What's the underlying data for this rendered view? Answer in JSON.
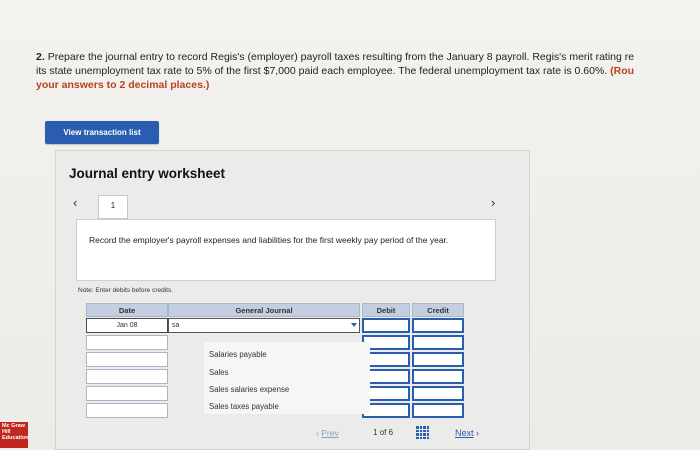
{
  "question": {
    "number": "2.",
    "line1": "Prepare the journal entry to record Regis's (employer) payroll taxes resulting from the January 8 payroll. Regis's merit rating re",
    "line2_text": "its state unemployment tax rate to 5% of the first $7,000 paid each employee. The federal unemployment tax rate is 0.60%.",
    "line2_red": "(Rou",
    "line3_red": "your answers to 2 decimal places.)"
  },
  "view_transaction_button": "View transaction list",
  "worksheet": {
    "title": "Journal entry worksheet",
    "page_tab": "1",
    "instruction": "Record the employer's payroll expenses and liabilities for the first weekly pay period of the year.",
    "note": "Note: Enter debits before credits.",
    "headers": {
      "date": "Date",
      "general_journal": "General Journal",
      "debit": "Debit",
      "credit": "Credit"
    },
    "rows": [
      {
        "date": "Jan 08",
        "account": "sa",
        "debit": "",
        "credit": ""
      },
      {
        "date": "",
        "account": "",
        "debit": "",
        "credit": ""
      },
      {
        "date": "",
        "account": "",
        "debit": "",
        "credit": ""
      },
      {
        "date": "",
        "account": "",
        "debit": "",
        "credit": ""
      },
      {
        "date": "",
        "account": "",
        "debit": "",
        "credit": ""
      },
      {
        "date": "",
        "account": "",
        "debit": "",
        "credit": ""
      }
    ],
    "dropdown_options": [
      "Salaries payable",
      "Sales",
      "Sales salaries expense",
      "Sales taxes payable"
    ]
  },
  "footer": {
    "logo_text": "Mc Graw Hill Education",
    "prev": "Prev",
    "page_current": "1",
    "page_of": "of",
    "page_total": "6",
    "next": "Next"
  },
  "colors": {
    "accent": "#2a5db0",
    "emphasis": "#b8421f",
    "logo": "#c0271e"
  }
}
